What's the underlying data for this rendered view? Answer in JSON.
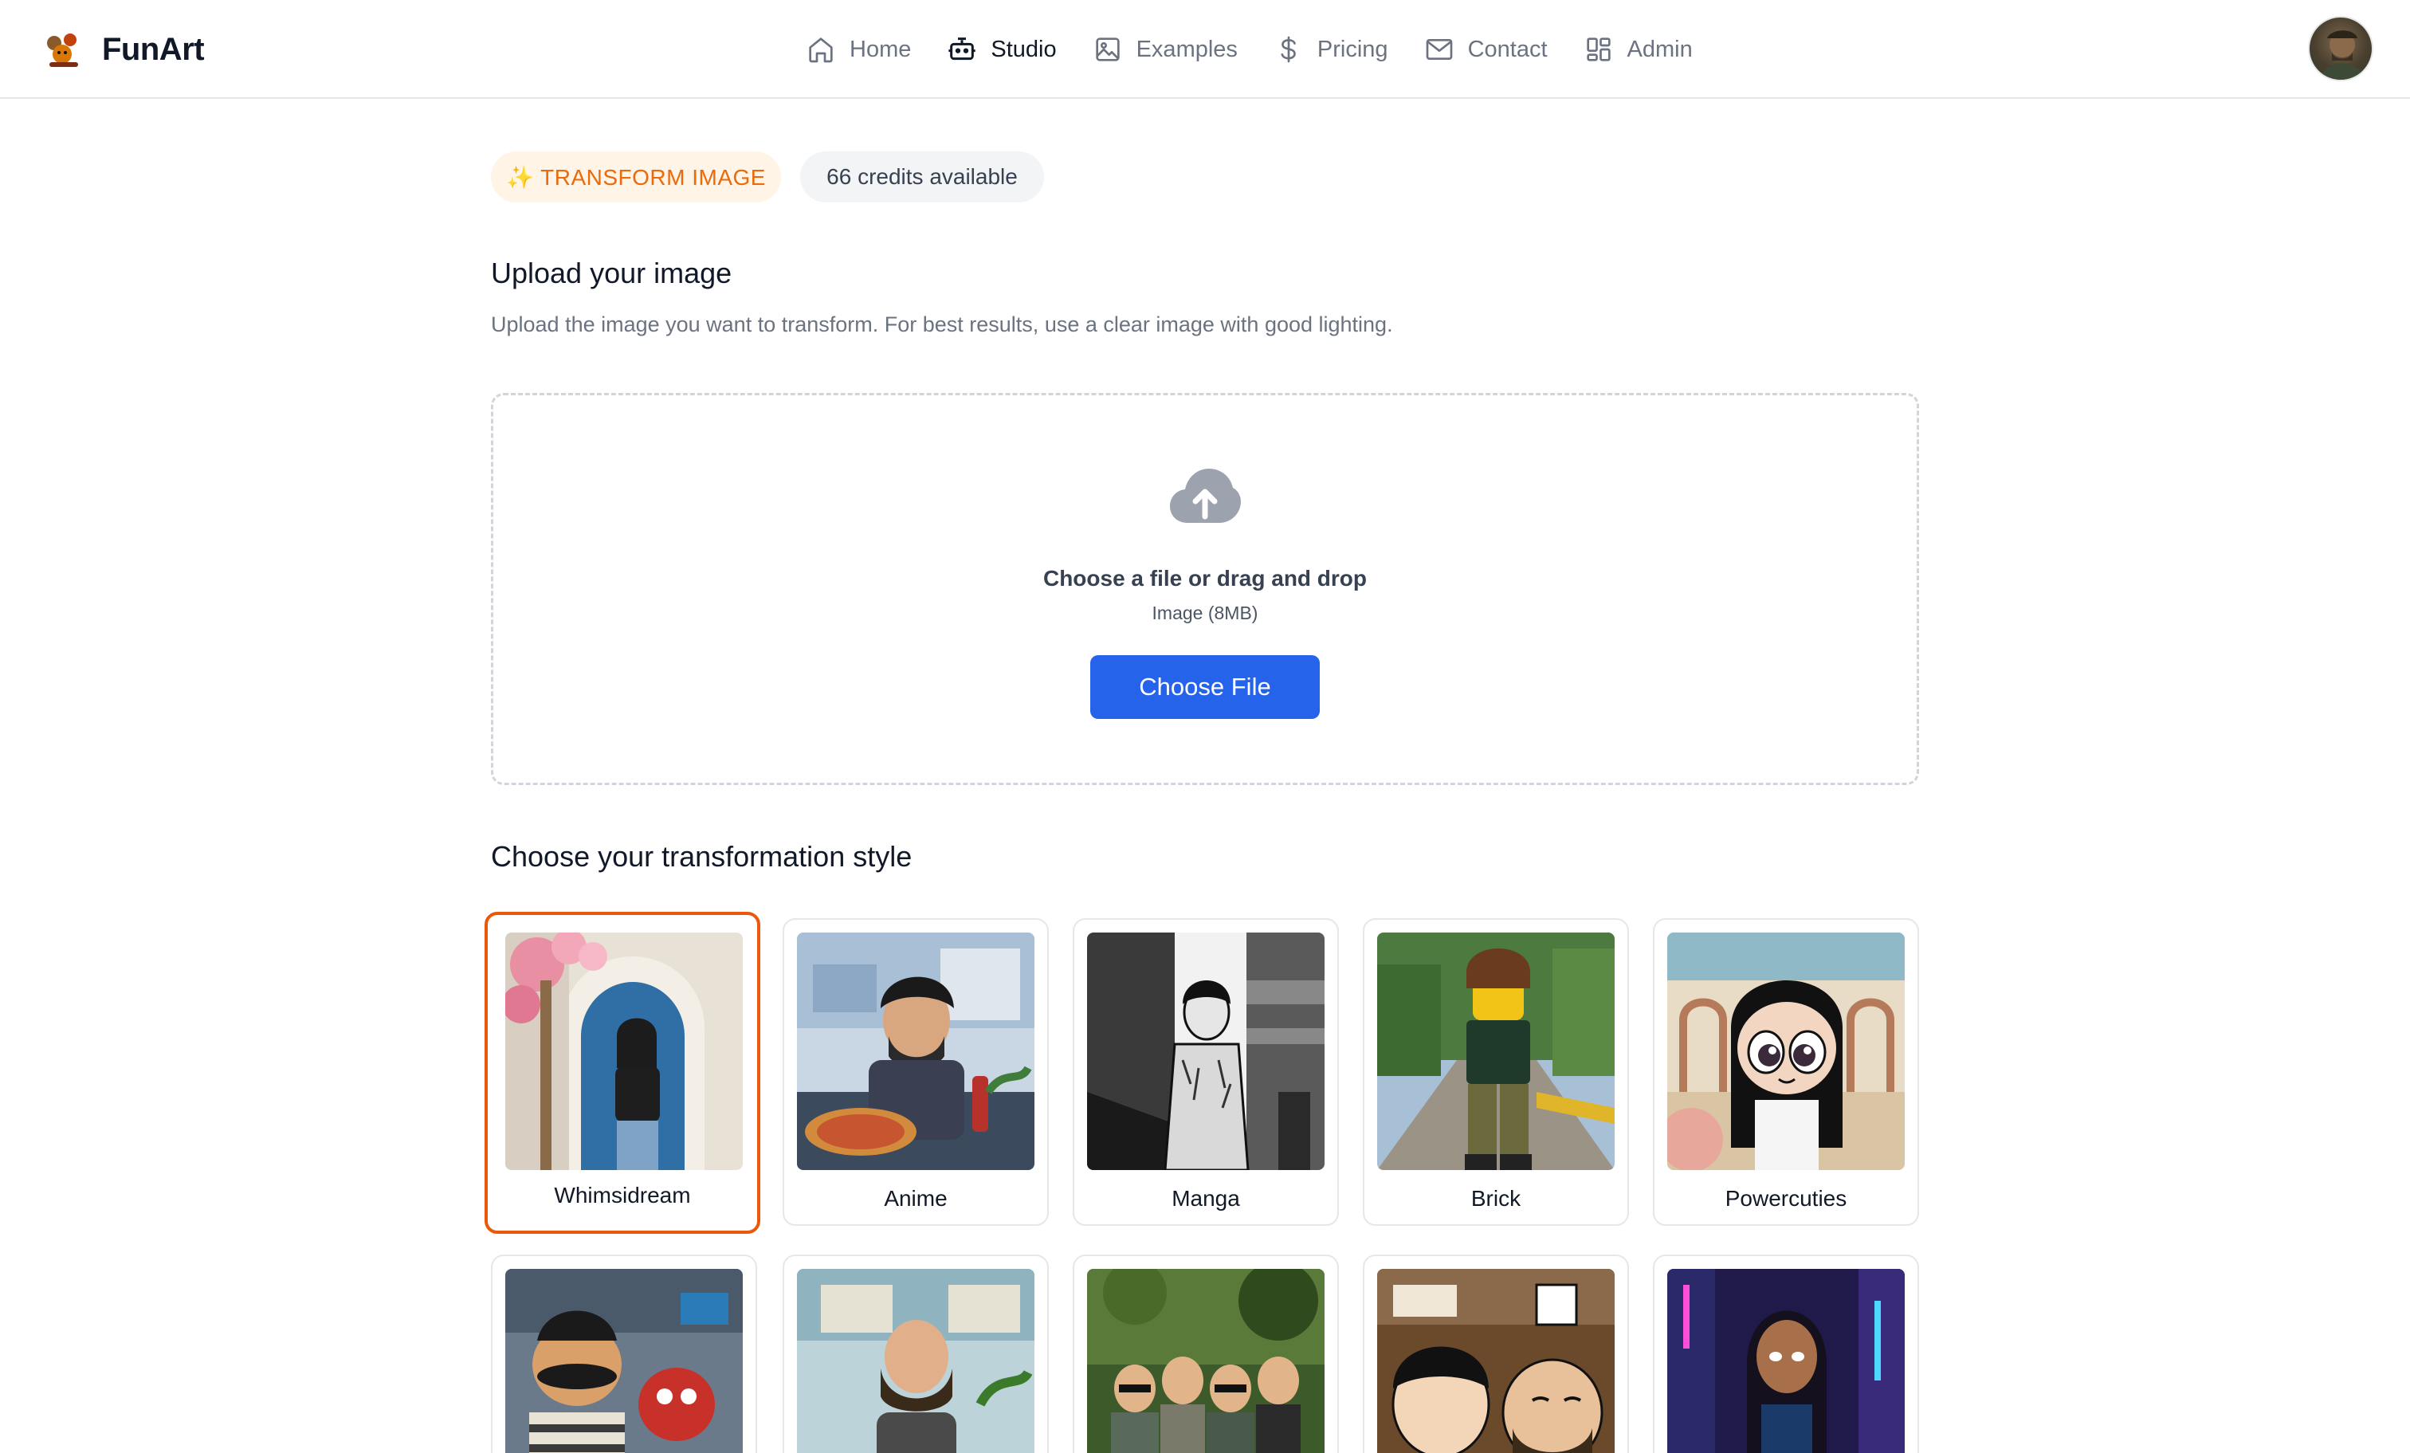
{
  "app": {
    "name": "FunArt"
  },
  "nav": {
    "items": [
      {
        "label": "Home",
        "icon": "home-icon"
      },
      {
        "label": "Studio",
        "icon": "robot-icon",
        "active": true
      },
      {
        "label": "Examples",
        "icon": "image-icon"
      },
      {
        "label": "Pricing",
        "icon": "dollar-icon"
      },
      {
        "label": "Contact",
        "icon": "mail-icon"
      },
      {
        "label": "Admin",
        "icon": "grid-icon"
      }
    ]
  },
  "badges": {
    "transform": "✨ TRANSFORM IMAGE",
    "credits": "66 credits available"
  },
  "upload": {
    "title": "Upload your image",
    "description": "Upload the image you want to transform. For best results, use a clear image with good lighting.",
    "drop_title": "Choose a file or drag and drop",
    "drop_sub": "Image (8MB)",
    "button": "Choose File"
  },
  "styles": {
    "title": "Choose your transformation style",
    "selected": "Whimsidream",
    "items": [
      {
        "label": "Whimsidream"
      },
      {
        "label": "Anime"
      },
      {
        "label": "Manga"
      },
      {
        "label": "Brick"
      },
      {
        "label": "Powercuties"
      }
    ]
  },
  "colors": {
    "accent": "#2563eb",
    "selected_border": "#ea580c",
    "badge_text": "#ea6a0c",
    "badge_bg": "#fff4e5"
  }
}
